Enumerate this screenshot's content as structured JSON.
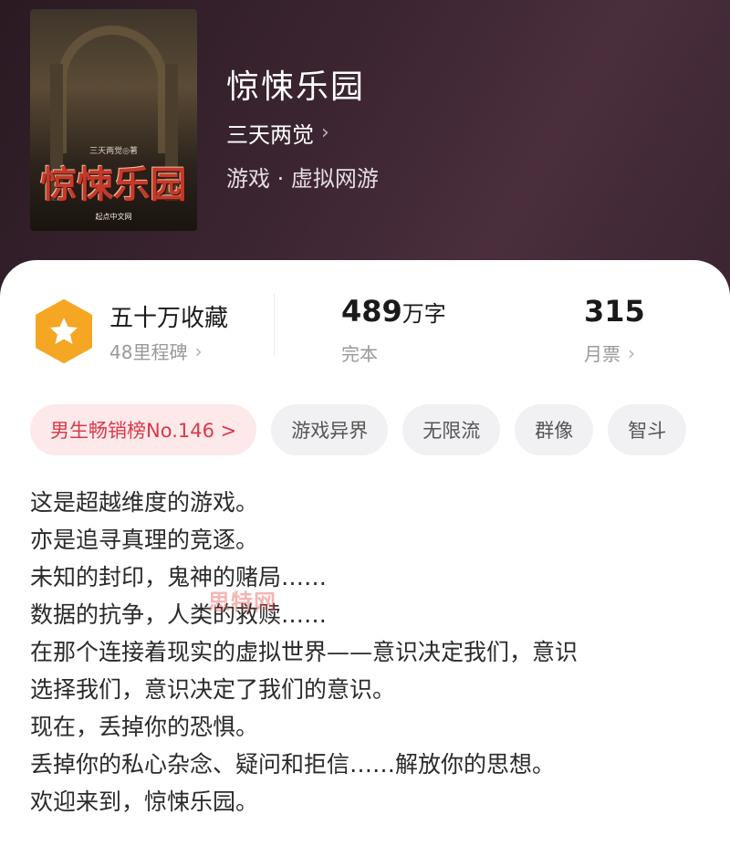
{
  "book": {
    "title": "惊悚乐园",
    "author": "三天两觉",
    "author_chevron": "›",
    "genre": "游戏 · 虚拟网游",
    "cover": {
      "small_text": "三天两觉◎著",
      "title": "惊悚乐园",
      "publisher": "起点中文网"
    }
  },
  "stats": {
    "favorites_label": "五十万收藏",
    "milestones_label": "48里程碑",
    "word_count_value": "489",
    "word_count_unit": "万字",
    "status_label": "完本",
    "monthly_votes_value": "315",
    "monthly_votes_label": "月票",
    "chevron": "›"
  },
  "tags": [
    "男生畅销榜No.146 >",
    "游戏异界",
    "无限流",
    "群像",
    "智斗"
  ],
  "description": [
    "这是超越维度的游戏。",
    "亦是追寻真理的竞逐。",
    "未知的封印，鬼神的赌局……",
    "数据的抗争，人类的救赎……",
    "在那个连接着现实的虚拟世界——意识决定我们，意识",
    "选择我们，意识决定了我们的意识。",
    "现在，丢掉你的恐惧。",
    "丢掉你的私心杂念、疑问和拒信……解放你的思想。",
    "欢迎来到，惊悚乐园。"
  ],
  "watermark": "思特网",
  "colors": {
    "header_bg": "#3a2430",
    "badge": "#f5a623",
    "rank_tag_bg": "#fde9ea",
    "rank_tag_text": "#d93a4a"
  }
}
